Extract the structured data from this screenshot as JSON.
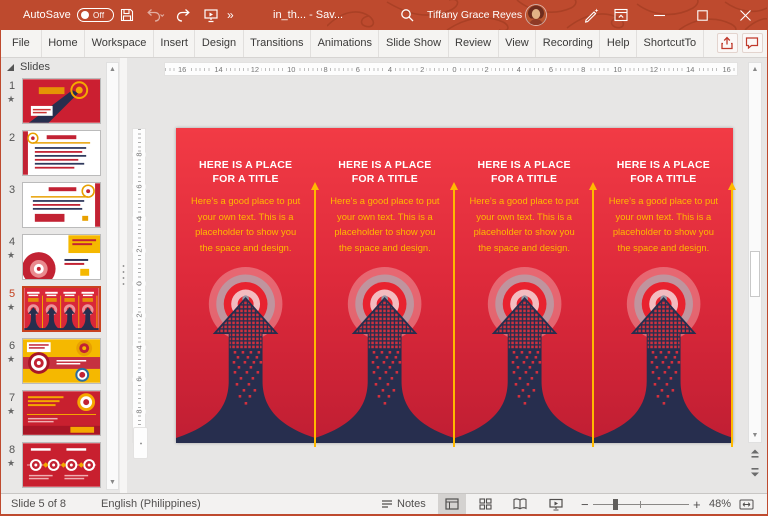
{
  "titlebar": {
    "autosave_label": "AutoSave",
    "autosave_state": "Off",
    "more_chevron": "»",
    "filename": "in_th...  -  Sav...",
    "user": "Tiffany Grace Reyes"
  },
  "menu": {
    "tabs": [
      {
        "label": "File"
      },
      {
        "label": "Home"
      },
      {
        "label": "Workspace"
      },
      {
        "label": "Insert"
      },
      {
        "label": "Design"
      },
      {
        "label": "Transitions"
      },
      {
        "label": "Animations"
      },
      {
        "label": "Slide Show"
      },
      {
        "label": "Review"
      },
      {
        "label": "View"
      },
      {
        "label": "Recording"
      },
      {
        "label": "Help"
      },
      {
        "label": "ShortcutTo"
      }
    ]
  },
  "slides_panel": {
    "header": "Slides",
    "items": [
      {
        "number": "1",
        "star": "★"
      },
      {
        "number": "2",
        "star": ""
      },
      {
        "number": "3",
        "star": ""
      },
      {
        "number": "4",
        "star": "★"
      },
      {
        "number": "5",
        "star": "★"
      },
      {
        "number": "6",
        "star": "★"
      },
      {
        "number": "7",
        "star": "★"
      },
      {
        "number": "8",
        "star": "★"
      }
    ],
    "selected_index": 4
  },
  "ruler": {
    "h": [
      "16",
      "14",
      "12",
      "10",
      "8",
      "6",
      "4",
      "2",
      "0",
      "2",
      "4",
      "6",
      "8",
      "10",
      "12",
      "14",
      "16"
    ],
    "v": [
      "8",
      "6",
      "4",
      "2",
      "0",
      "2",
      "4",
      "6",
      "8"
    ]
  },
  "slide": {
    "columns": [
      {
        "title": "HERE IS A PLACE FOR A TITLE",
        "body": "Here’s a good place to put your own text. This is a placeholder to show you the space and design."
      },
      {
        "title": "HERE IS A PLACE FOR A TITLE",
        "body": "Here’s a good place to put your own text. This is a placeholder to show you the space and design."
      },
      {
        "title": "HERE IS A PLACE FOR A TITLE",
        "body": "Here’s a good place to put your own text. This is a placeholder to show you the space and design."
      },
      {
        "title": "HERE IS A PLACE FOR A TITLE",
        "body": "Here’s a good place to put your own text. This is a placeholder to show you the space and design."
      }
    ]
  },
  "statusbar": {
    "slide_indicator": "Slide 5 of 8",
    "language": "English (Philippines)",
    "notes_label": "Notes",
    "zoom_level": "48%"
  },
  "colors": {
    "titlebar": "#BE4A2E",
    "accent_red": "#C8421F",
    "slide_red_top": "#F23B45",
    "slide_red_bottom": "#C01E33",
    "navy": "#272E4E",
    "gold": "#FFB900"
  }
}
